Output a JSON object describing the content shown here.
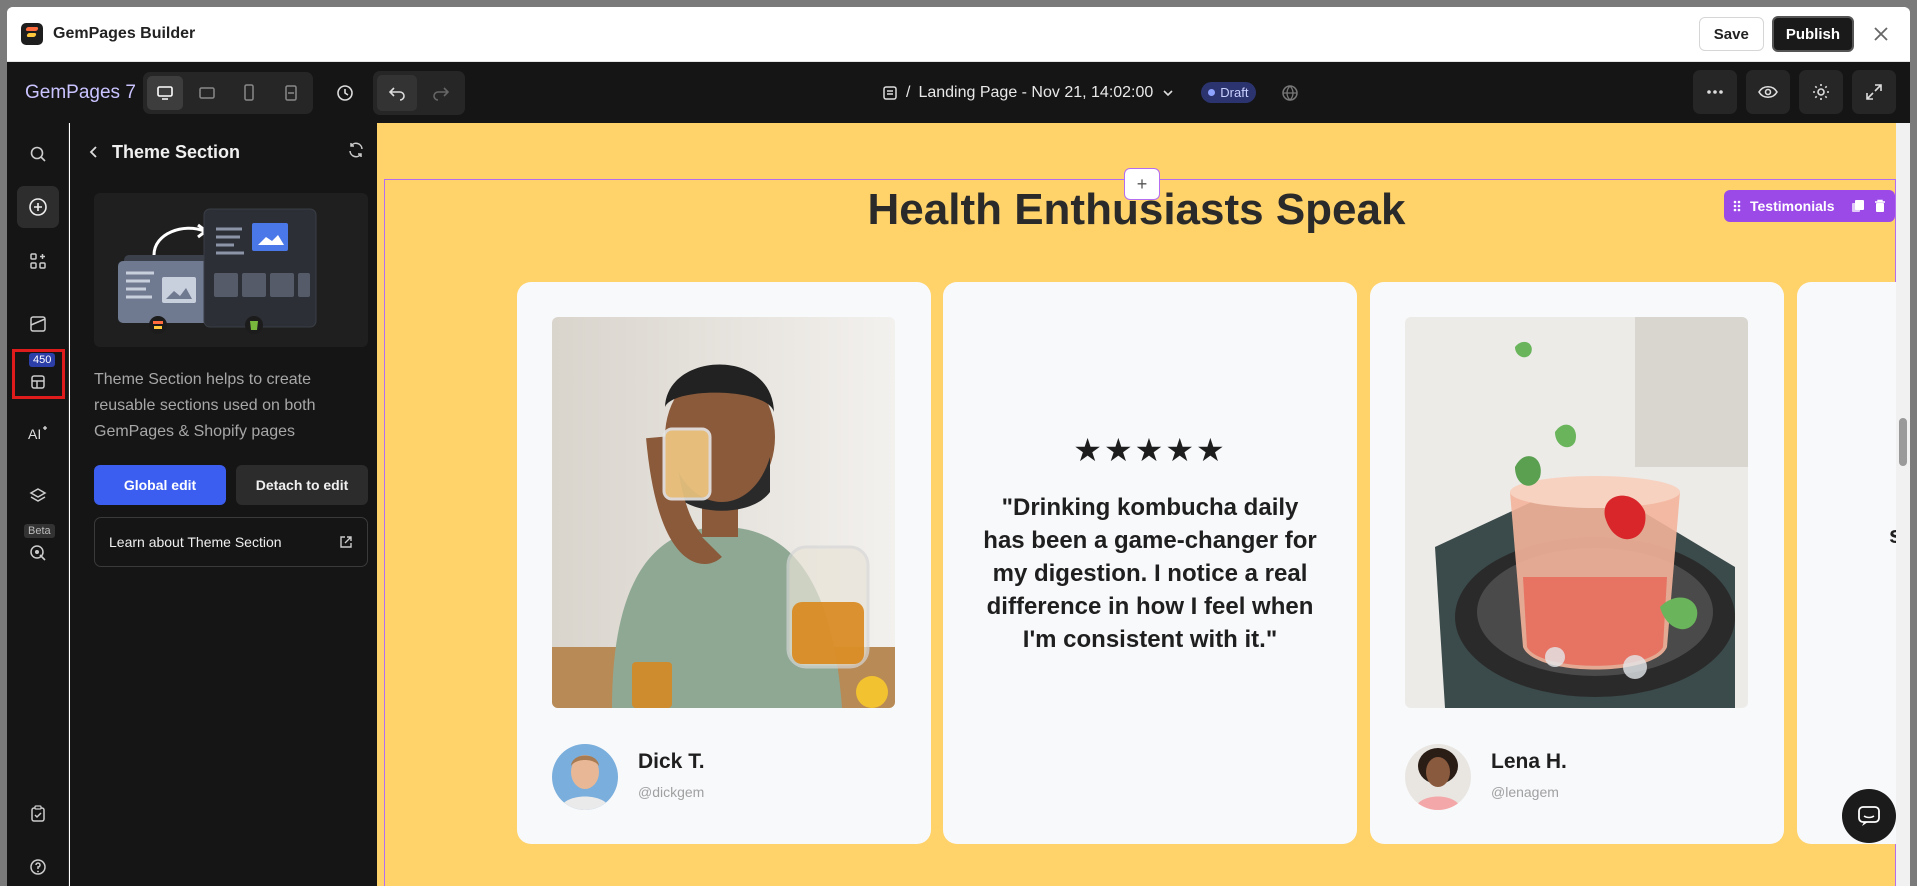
{
  "titlebar": {
    "app_title": "GemPages Builder",
    "save_label": "Save",
    "publish_label": "Publish"
  },
  "toolbar": {
    "brand": "GemPages 7",
    "page_prefix": "/",
    "page_name": "Landing Page - Nov 21, 14:02:00",
    "status": "Draft"
  },
  "rail": {
    "badge_count": "450",
    "beta_label": "Beta"
  },
  "panel": {
    "title": "Theme Section",
    "description": "Theme Section helps to create reusable sections used on both GemPages & Shopify pages",
    "global_edit_label": "Global edit",
    "detach_label": "Detach to edit",
    "learn_label": "Learn about Theme Section"
  },
  "canvas": {
    "section_tag": "Testimonials",
    "heading": "Health Enthusiasts Speak",
    "cards": [
      {
        "name": "Dick T.",
        "handle": "@dickgem"
      },
      {
        "stars": "★★★★★",
        "quote": "\"Drinking kombucha daily has been a game-changer for my digestion. I notice a real difference in how I feel when I'm consistent with it.\""
      },
      {
        "name": "Lena H.",
        "handle": "@lenagem"
      },
      {
        "quote_partial": "\"\nstrug\nlo\n \nsust\nth"
      }
    ]
  },
  "colors": {
    "accent": "#3c5ef0",
    "canvas_bg": "#ffd26a",
    "section_tag": "#9b4ae8",
    "highlight": "#e01b1b"
  }
}
